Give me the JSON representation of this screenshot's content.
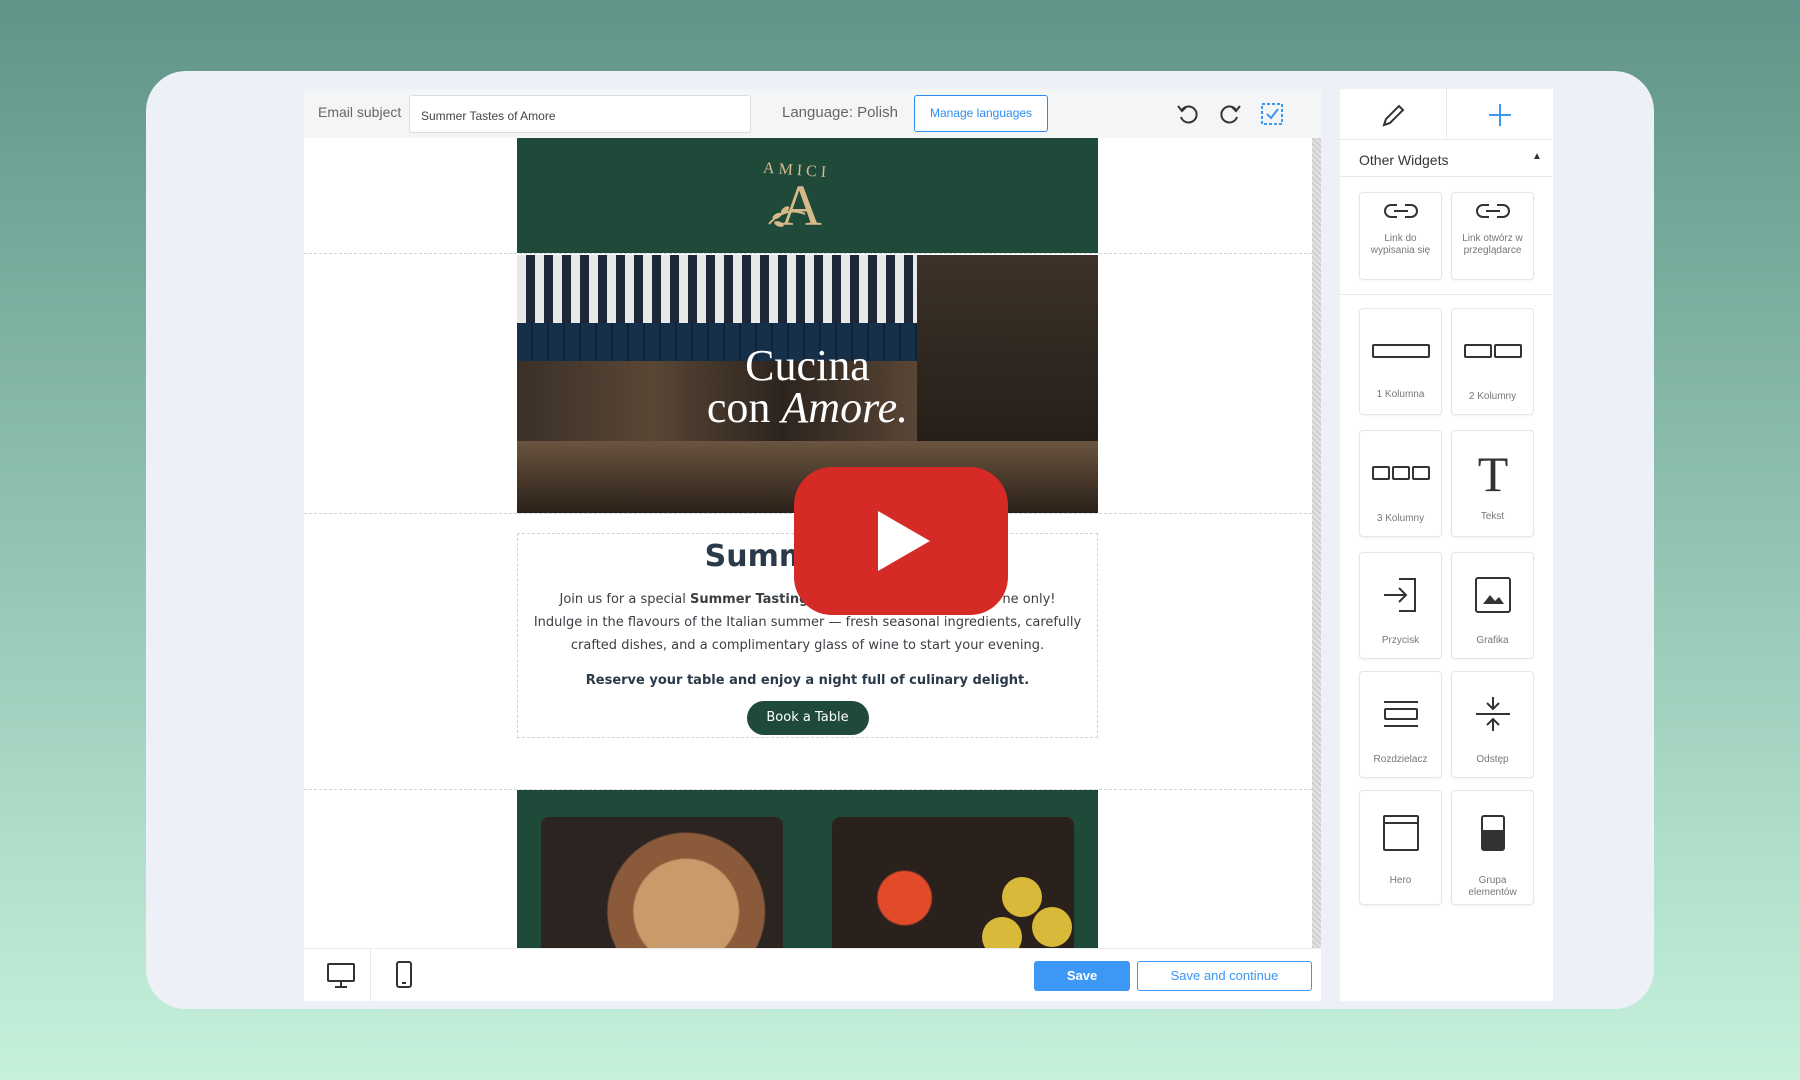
{
  "topbar": {
    "subject_label": "Email subject",
    "subject_value": "Summer Tastes of Amore",
    "language_label": "Language: Polish",
    "manage_languages": "Manage languages"
  },
  "email": {
    "logo_text": "AMICI",
    "logo_letter": "A",
    "hero_line1": "Cucina",
    "hero_line2_prefix": "con ",
    "hero_line2_italic": "Amore.",
    "title": "Summer Tas",
    "body_line1_a": "Join us for a special ",
    "body_line1_b": "Summer Tasting",
    "body_line1_c": "ne only!",
    "body_line2": "Indulge in the flavours of the Italian summer — fresh seasonal ingredients, carefully",
    "body_line3": "crafted dishes, and a complimentary glass of wine to start your evening.",
    "cta": "Reserve your table and enjoy a night full of culinary delight.",
    "book_button": "Book a Table"
  },
  "bottom": {
    "save": "Save",
    "save_continue": "Save and continue"
  },
  "panel": {
    "section_title": "Other Widgets",
    "widgets": [
      {
        "label": "Link do wypisania się",
        "icon": "link-icon"
      },
      {
        "label": "Link otwórz w przeglądarce",
        "icon": "link-icon"
      },
      {
        "label": "1 Kolumna",
        "icon": "one-column-icon"
      },
      {
        "label": "2 Kolumny",
        "icon": "two-columns-icon"
      },
      {
        "label": "3 Kolumny",
        "icon": "three-columns-icon"
      },
      {
        "label": "Tekst",
        "icon": "text-icon"
      },
      {
        "label": "Przycisk",
        "icon": "button-icon"
      },
      {
        "label": "Grafika",
        "icon": "image-icon"
      },
      {
        "label": "Rozdzielacz",
        "icon": "divider-icon"
      },
      {
        "label": "Odstęp",
        "icon": "spacer-icon"
      },
      {
        "label": "Hero",
        "icon": "hero-icon"
      },
      {
        "label": "Grupa elementów",
        "icon": "group-icon"
      }
    ]
  },
  "colors": {
    "brand_green": "#1f4a3a",
    "gold": "#d7b98a",
    "accent_blue": "#3d97f5",
    "youtube_red": "#e02f2f"
  }
}
